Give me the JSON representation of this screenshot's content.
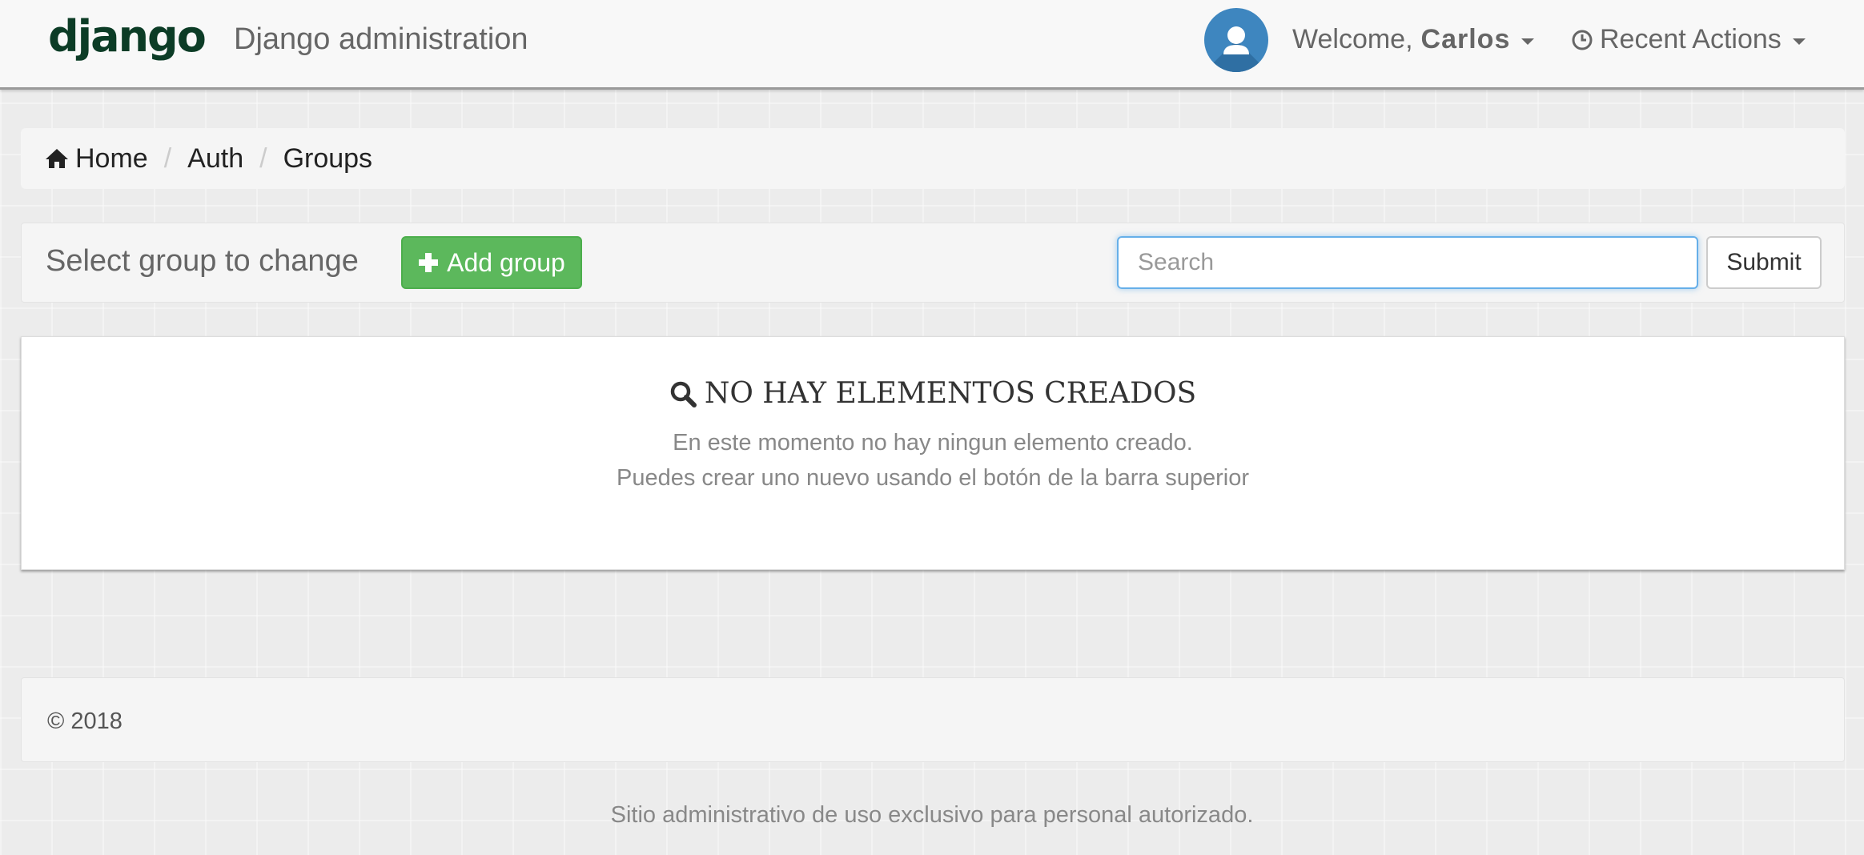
{
  "navbar": {
    "brand": "django",
    "site_title": "Django administration",
    "welcome_prefix": "Welcome,",
    "username": "Carlos",
    "recent_actions": "Recent Actions"
  },
  "breadcrumb": {
    "items": [
      "Home",
      "Auth",
      "Groups"
    ],
    "separator": "/"
  },
  "toolbar": {
    "heading": "Select group to change",
    "add_label": "Add group",
    "search_placeholder": "Search",
    "search_value": "",
    "submit_label": "Submit"
  },
  "empty_state": {
    "title": "NO HAY ELEMENTOS CREADOS",
    "line1": "En este momento no hay ningun elemento creado.",
    "line2": "Puedes crear uno nuevo usando el botón de la barra superior"
  },
  "footer": {
    "copyright": "© 2018",
    "disclaimer": "Sitio administrativo de uso exclusivo para personal autorizado."
  },
  "icons": {
    "home": "home-icon",
    "plus": "plus-icon",
    "search": "search-icon",
    "clock": "clock-icon",
    "user": "user-avatar-icon"
  },
  "colors": {
    "brand": "#0c3c26",
    "add_button": "#5cb85c",
    "avatar": "#3e86bf",
    "search_focus": "#66afe9"
  }
}
